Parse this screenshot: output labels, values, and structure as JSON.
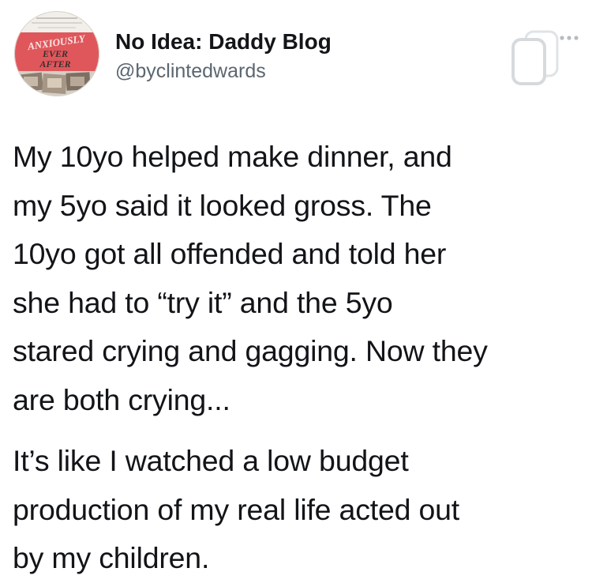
{
  "post": {
    "author": {
      "display_name": "No Idea: Daddy Blog",
      "handle": "@byclintedwards",
      "avatar_text": [
        "ANXIOUSLY",
        "EVER",
        "AFTER"
      ]
    },
    "paragraphs": [
      "My 10yo helped make dinner, and\nmy 5yo said it looked gross. The\n10yo got all offended and told her\nshe had to “try it” and the 5yo\nstared crying and gagging. Now they\nare both crying...",
      "It’s like I watched a low budget\nproduction of my real life acted out\nby my children."
    ],
    "icons": {
      "share": "share-icon",
      "more": "more-options-icon"
    }
  },
  "colors": {
    "avatar_accent": "#e0575b",
    "handle": "#5b6670",
    "text": "#121418"
  }
}
